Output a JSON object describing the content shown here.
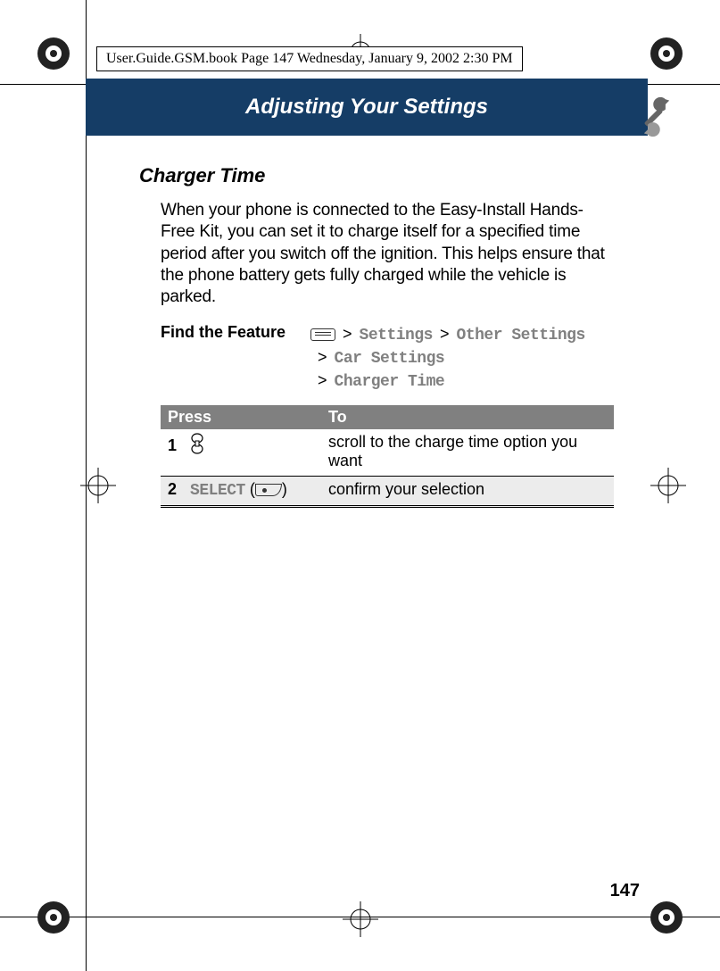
{
  "running_header": "User.Guide.GSM.book  Page 147  Wednesday, January 9, 2002  2:30 PM",
  "chapter_title": "Adjusting Your Settings",
  "section_title": "Charger Time",
  "body_paragraph": "When your phone is connected to the Easy-Install Hands-Free Kit, you can set it to charge itself for a specified time period after you switch off the ignition. This helps ensure that the phone battery gets fully charged while the vehicle is parked.",
  "find_feature": {
    "label": "Find the Feature",
    "path": {
      "sep": ">",
      "level1": "Settings",
      "level2": "Other Settings",
      "level3": "Car Settings",
      "level4": "Charger Time"
    }
  },
  "table": {
    "head_press": "Press",
    "head_to": "To",
    "rows": [
      {
        "num": "1",
        "press_label": "",
        "to": "scroll to the charge time option you want"
      },
      {
        "num": "2",
        "press_label": "SELECT",
        "to": "confirm your selection"
      }
    ]
  },
  "page_number": "147"
}
